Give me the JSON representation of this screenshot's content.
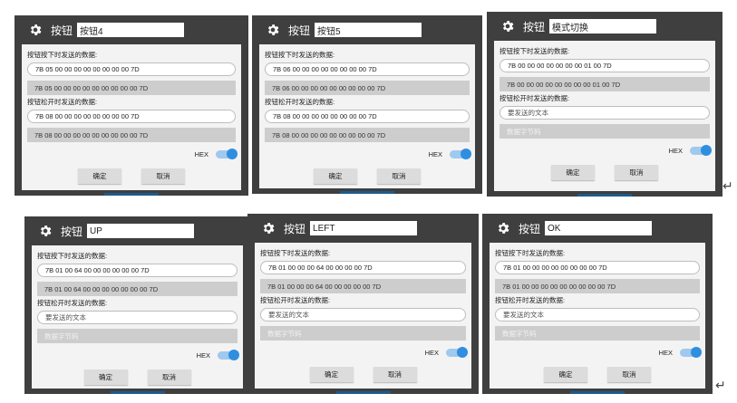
{
  "dialogs": [
    {
      "title_label": "按钮",
      "name_value": "按钮4",
      "press_label": "按钮按下时发送的数据:",
      "press_input": "7B 05 00 00 00 00 00 00 00 00 7D",
      "press_preview": "7B 05 00 00 00 00 00 00 00 00 00 7D",
      "release_label": "按钮松开时发送的数据:",
      "release_input": "7B 08 00 00 00 00 00 00 00 00 7D",
      "release_preview": "7B 08 00 00 00 00 00 00 00 00 00 7D",
      "hex_label": "HEX",
      "confirm_label": "确定",
      "cancel_label": "取消"
    },
    {
      "title_label": "按钮",
      "name_value": "按钮5",
      "press_label": "按钮按下时发送的数据:",
      "press_input": "7B 06 00 00 00 00 00 00 00 00 7D",
      "press_preview": "7B 06 00 00 00 00 00 00 00 00 00 7D",
      "release_label": "按钮松开时发送的数据:",
      "release_input": "7B 08 00 00 00 00 00 00 00 00 7D",
      "release_preview": "7B 08 00 00 00 00 00 00 00 00 00 7D",
      "hex_label": "HEX",
      "confirm_label": "确定",
      "cancel_label": "取消"
    },
    {
      "title_label": "按钮",
      "name_value": "模式切换",
      "press_label": "按钮按下时发送的数据:",
      "press_input": "7B 00 00 00 00 00 00 00 01 00 7D",
      "press_preview": "7B 00 00 00 00 00 00 00 00 01 00 7D",
      "release_label": "按钮松开时发送的数据:",
      "release_input": "要发送的文本",
      "release_preview": "数据字节码",
      "hex_label": "HEX",
      "confirm_label": "确定",
      "cancel_label": "取消"
    },
    {
      "title_label": "按钮",
      "name_value": "UP",
      "press_label": "按钮按下时发送的数据:",
      "press_input": "7B 01 00 64 00 00 00 00 00 00 7D",
      "press_preview": "7B 01 00 64 00 00 00 00 00 00 00 7D",
      "release_label": "按钮松开时发送的数据:",
      "release_input": "要发送的文本",
      "release_preview": "数据字节码",
      "hex_label": "HEX",
      "confirm_label": "确定",
      "cancel_label": "取消"
    },
    {
      "title_label": "按钮",
      "name_value": "LEFT",
      "press_label": "按钮按下时发送的数据:",
      "press_input": "7B 01 00 00 00 64 00 00 00 00 7D",
      "press_preview": "7B 01 00 00 00 64 00 00 00 00 00 7D",
      "release_label": "按钮松开时发送的数据:",
      "release_input": "要发送的文本",
      "release_preview": "数据字节码",
      "hex_label": "HEX",
      "confirm_label": "确定",
      "cancel_label": "取消"
    },
    {
      "title_label": "按钮",
      "name_value": "OK",
      "press_label": "按钮按下时发送的数据:",
      "press_input": "7B 01 00 00 00 00 00 00 00 00 7D",
      "press_preview": "7B 01 00 00 00 00 00 00 00 00 00 7D",
      "release_label": "按钮松开时发送的数据:",
      "release_input": "要发送的文本",
      "release_preview": "数据字节码",
      "hex_label": "HEX",
      "confirm_label": "确定",
      "cancel_label": "取消"
    }
  ],
  "return_symbol": "↵",
  "colors": {
    "frame": "#3f3f3f",
    "body": "#f3f3f3",
    "toggle_on": "#2f8ee0",
    "gray_field": "#cdcdcd"
  }
}
